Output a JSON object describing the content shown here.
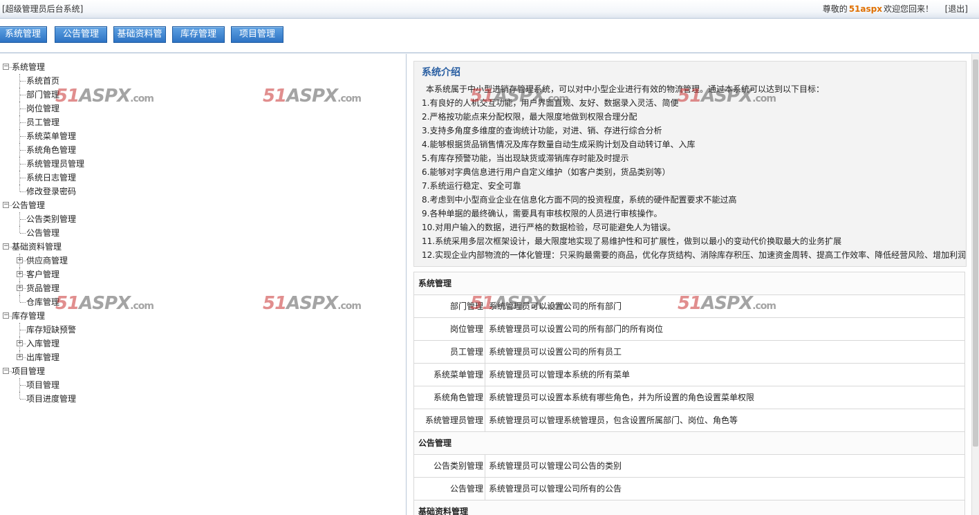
{
  "header": {
    "system_title": "[超级管理员后台系统]",
    "welcome_prefix": "尊敬的",
    "username": "51aspx",
    "welcome_suffix": "欢迎您回来！",
    "logout_label": "[退出]"
  },
  "menu": {
    "items": [
      "系统管理",
      "公告管理",
      "基础资料管理",
      "库存管理",
      "项目管理"
    ]
  },
  "tree": {
    "nodes": [
      {
        "label": "系统管理",
        "level": 0,
        "expander": "minus"
      },
      {
        "label": "系统首页",
        "level": 1
      },
      {
        "label": "部门管理",
        "level": 1
      },
      {
        "label": "岗位管理",
        "level": 1
      },
      {
        "label": "员工管理",
        "level": 1
      },
      {
        "label": "系统菜单管理",
        "level": 1
      },
      {
        "label": "系统角色管理",
        "level": 1
      },
      {
        "label": "系统管理员管理",
        "level": 1
      },
      {
        "label": "系统日志管理",
        "level": 1
      },
      {
        "label": "修改登录密码",
        "level": 1
      },
      {
        "label": "公告管理",
        "level": 0,
        "expander": "minus"
      },
      {
        "label": "公告类别管理",
        "level": 1
      },
      {
        "label": "公告管理",
        "level": 1
      },
      {
        "label": "基础资料管理",
        "level": 0,
        "expander": "minus"
      },
      {
        "label": "供应商管理",
        "level": 1,
        "expander": "plus"
      },
      {
        "label": "客户管理",
        "level": 1,
        "expander": "plus"
      },
      {
        "label": "货品管理",
        "level": 1,
        "expander": "plus"
      },
      {
        "label": "仓库管理",
        "level": 1
      },
      {
        "label": "库存管理",
        "level": 0,
        "expander": "minus"
      },
      {
        "label": "库存短缺预警",
        "level": 1
      },
      {
        "label": "入库管理",
        "level": 1,
        "expander": "plus"
      },
      {
        "label": "出库管理",
        "level": 1,
        "expander": "plus"
      },
      {
        "label": "项目管理",
        "level": 0,
        "expander": "minus"
      },
      {
        "label": "项目管理",
        "level": 1
      },
      {
        "label": "项目进度管理",
        "level": 1
      }
    ]
  },
  "intro": {
    "title": "系统介绍",
    "lines": [
      "本系统属于中小型进销存管理系统，可以对中小型企业进行有效的物流管理。通过本系统可以达到以下目标：",
      "1.有良好的人机交互功能，用户界面直观、友好、数据录入灵活、简便",
      "2.严格按功能点来分配权限，最大限度地做到权限合理分配",
      "3.支持多角度多维度的查询统计功能，对进、销、存进行综合分析",
      "4.能够根据货品销售情况及库存数量自动生成采购计划及自动转订单、入库",
      "5.有库存预警功能，当出现缺货或滞销库存时能及时提示",
      "6.能够对字典信息进行用户自定义维护（如客户类别，货品类别等）",
      "7.系统运行稳定、安全可靠",
      "8.考虑到中小型商业企业在信息化方面不同的投资程度，系统的硬件配置要求不能过高",
      "9.各种单据的最终确认，需要具有审核权限的人员进行审核操作。",
      "10.对用户输入的数据，进行严格的数据检验，尽可能避免人为错误。",
      "11.系统采用多层次框架设计，最大限度地实现了易维护性和可扩展性，做到以最小的变动代价换取最大的业务扩展",
      "12.实现企业内部物流的一体化管理：只采购最需要的商品，优化存货结构、消除库存积压、加速资金周转、提高工作效率、降低经营风险、增加利润"
    ]
  },
  "modules": {
    "rows": [
      {
        "type": "section",
        "title": "系统管理"
      },
      {
        "type": "row",
        "name": "部门管理",
        "desc": "系统管理员可以设置公司的所有部门"
      },
      {
        "type": "row",
        "name": "岗位管理",
        "desc": "系统管理员可以设置公司的所有部门的所有岗位"
      },
      {
        "type": "row",
        "name": "员工管理",
        "desc": "系统管理员可以设置公司的所有员工"
      },
      {
        "type": "row",
        "name": "系统菜单管理",
        "desc": "系统管理员可以管理本系统的所有菜单"
      },
      {
        "type": "row",
        "name": "系统角色管理",
        "desc": "系统管理员可以设置本系统有哪些角色，并为所设置的角色设置菜单权限"
      },
      {
        "type": "row",
        "name": "系统管理员管理",
        "desc": "系统管理员可以管理系统管理员，包含设置所属部门、岗位、角色等"
      },
      {
        "type": "section",
        "title": "公告管理"
      },
      {
        "type": "row",
        "name": "公告类别管理",
        "desc": "系统管理员可以管理公司公告的类别"
      },
      {
        "type": "row",
        "name": "公告管理",
        "desc": "系统管理员可以管理公司所有的公告"
      },
      {
        "type": "section",
        "title": "基础资料管理"
      }
    ]
  },
  "watermark": {
    "text_red": "51",
    "text_gray": "ASPX",
    "text_suffix": ".com"
  }
}
